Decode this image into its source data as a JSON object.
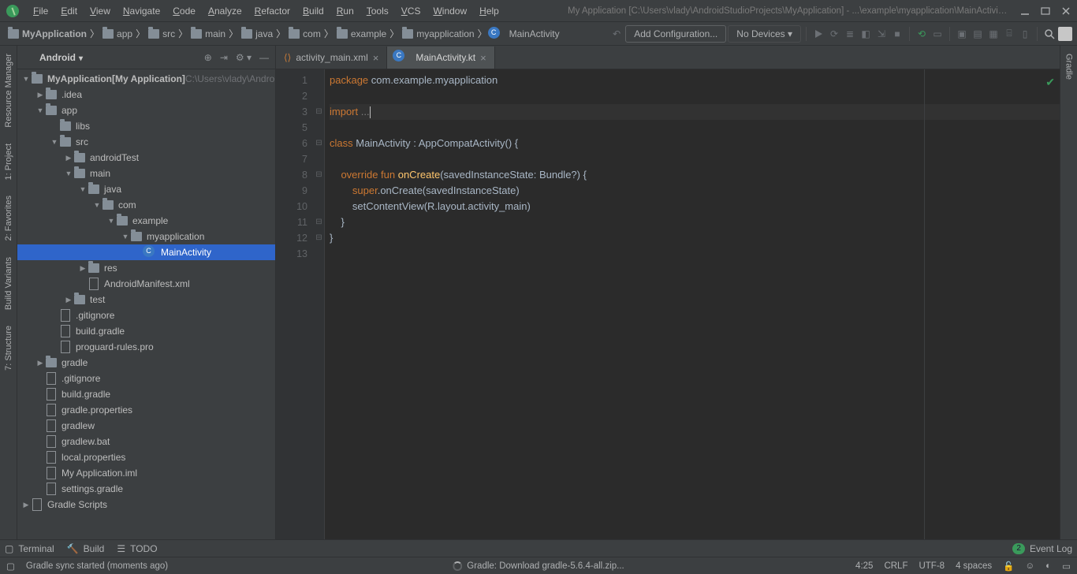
{
  "menu": {
    "items": [
      "File",
      "Edit",
      "View",
      "Navigate",
      "Code",
      "Analyze",
      "Refactor",
      "Build",
      "Run",
      "Tools",
      "VCS",
      "Window",
      "Help"
    ],
    "accel": [
      "F",
      "E",
      "V",
      "N",
      "C",
      "A",
      "R",
      "B",
      "R",
      "T",
      "V",
      "W",
      "H"
    ]
  },
  "window_title": "My Application [C:\\Users\\vlady\\AndroidStudioProjects\\MyApplication] - ...\\example\\myapplication\\MainActivity.kt",
  "breadcrumb": [
    "MyApplication",
    "app",
    "src",
    "main",
    "java",
    "com",
    "example",
    "myapplication",
    "MainActivity"
  ],
  "toolbar": {
    "add_config": "Add Configuration...",
    "no_devices": "No Devices"
  },
  "left_gutter": [
    "Resource Manager",
    "1: Project",
    "2: Favorites",
    "Build Variants",
    "7: Structure"
  ],
  "right_gutter": [
    "Gradle"
  ],
  "sidebar": {
    "mode": "Android",
    "root": {
      "label": "MyApplication",
      "suffix": "[My Application]",
      "path": "C:\\Users\\vlady\\Andro"
    },
    "items": [
      {
        "d": 1,
        "tw": "closed",
        "icon": "folder",
        "label": ".idea"
      },
      {
        "d": 1,
        "tw": "open",
        "icon": "folder",
        "label": "app"
      },
      {
        "d": 2,
        "tw": "",
        "icon": "folder",
        "label": "libs"
      },
      {
        "d": 2,
        "tw": "open",
        "icon": "folder",
        "label": "src"
      },
      {
        "d": 3,
        "tw": "closed",
        "icon": "folder",
        "label": "androidTest"
      },
      {
        "d": 3,
        "tw": "open",
        "icon": "folder",
        "label": "main"
      },
      {
        "d": 4,
        "tw": "open",
        "icon": "folder",
        "label": "java"
      },
      {
        "d": 5,
        "tw": "open",
        "icon": "folder",
        "label": "com"
      },
      {
        "d": 6,
        "tw": "open",
        "icon": "folder",
        "label": "example"
      },
      {
        "d": 7,
        "tw": "open",
        "icon": "folder",
        "label": "myapplication"
      },
      {
        "d": 8,
        "tw": "",
        "icon": "kt",
        "label": "MainActivity",
        "sel": true
      },
      {
        "d": 4,
        "tw": "closed",
        "icon": "folder",
        "label": "res"
      },
      {
        "d": 4,
        "tw": "",
        "icon": "file",
        "label": "AndroidManifest.xml"
      },
      {
        "d": 3,
        "tw": "closed",
        "icon": "folder",
        "label": "test"
      },
      {
        "d": 2,
        "tw": "",
        "icon": "file",
        "label": ".gitignore"
      },
      {
        "d": 2,
        "tw": "",
        "icon": "file",
        "label": "build.gradle"
      },
      {
        "d": 2,
        "tw": "",
        "icon": "file",
        "label": "proguard-rules.pro"
      },
      {
        "d": 1,
        "tw": "closed",
        "icon": "folder",
        "label": "gradle"
      },
      {
        "d": 1,
        "tw": "",
        "icon": "file",
        "label": ".gitignore"
      },
      {
        "d": 1,
        "tw": "",
        "icon": "file",
        "label": "build.gradle"
      },
      {
        "d": 1,
        "tw": "",
        "icon": "file",
        "label": "gradle.properties"
      },
      {
        "d": 1,
        "tw": "",
        "icon": "file",
        "label": "gradlew"
      },
      {
        "d": 1,
        "tw": "",
        "icon": "file",
        "label": "gradlew.bat"
      },
      {
        "d": 1,
        "tw": "",
        "icon": "file",
        "label": "local.properties"
      },
      {
        "d": 1,
        "tw": "",
        "icon": "file",
        "label": "My Application.iml"
      },
      {
        "d": 1,
        "tw": "",
        "icon": "file",
        "label": "settings.gradle"
      }
    ],
    "scripts": {
      "label": "Gradle Scripts"
    }
  },
  "tabs": [
    {
      "icon": "xml",
      "label": "activity_main.xml",
      "active": false
    },
    {
      "icon": "kt",
      "label": "MainActivity.kt",
      "active": true
    }
  ],
  "code": {
    "lines": [
      {
        "n": 1,
        "segs": [
          [
            "kw",
            "package "
          ],
          [
            "pkg",
            "com.example.myapplication"
          ]
        ]
      },
      {
        "n": 2,
        "segs": []
      },
      {
        "n": 3,
        "hl": true,
        "fold": "⊟",
        "segs": [
          [
            "kw",
            "import "
          ],
          [
            "dim",
            "..."
          ]
        ],
        "caret": true
      },
      {
        "n": 5,
        "segs": []
      },
      {
        "n": 6,
        "fold": "⊟",
        "segs": [
          [
            "kw",
            "class "
          ],
          [
            "ty",
            "MainActivity : AppCompatActivity() {"
          ]
        ]
      },
      {
        "n": 7,
        "segs": []
      },
      {
        "n": 8,
        "fold": "⊟",
        "segs": [
          [
            "id",
            "    "
          ],
          [
            "ov",
            "override "
          ],
          [
            "kw",
            "fun "
          ],
          [
            "fn",
            "onCreate"
          ],
          [
            "id",
            "(savedInstanceState: Bundle?) {"
          ]
        ]
      },
      {
        "n": 9,
        "segs": [
          [
            "id",
            "        "
          ],
          [
            "sup",
            "super"
          ],
          [
            "id",
            ".onCreate(savedInstanceState)"
          ]
        ]
      },
      {
        "n": 10,
        "segs": [
          [
            "id",
            "        setContentView(R.layout."
          ],
          [
            "id",
            "activity_main"
          ],
          [
            "id",
            ")"
          ]
        ]
      },
      {
        "n": 11,
        "fold": "⊟",
        "segs": [
          [
            "id",
            "    }"
          ]
        ]
      },
      {
        "n": 12,
        "fold": "⊟",
        "segs": [
          [
            "id",
            "}"
          ]
        ]
      },
      {
        "n": 13,
        "segs": []
      }
    ]
  },
  "bottom": {
    "terminal": "Terminal",
    "build": "Build",
    "todo": "TODO",
    "event": "Event Log",
    "badge": "2"
  },
  "status": {
    "left": "Gradle sync started (moments ago)",
    "mid": "Gradle: Download gradle-5.6.4-all.zip...",
    "pos": "4:25",
    "eol": "CRLF",
    "enc": "UTF-8",
    "indent": "4 spaces"
  }
}
